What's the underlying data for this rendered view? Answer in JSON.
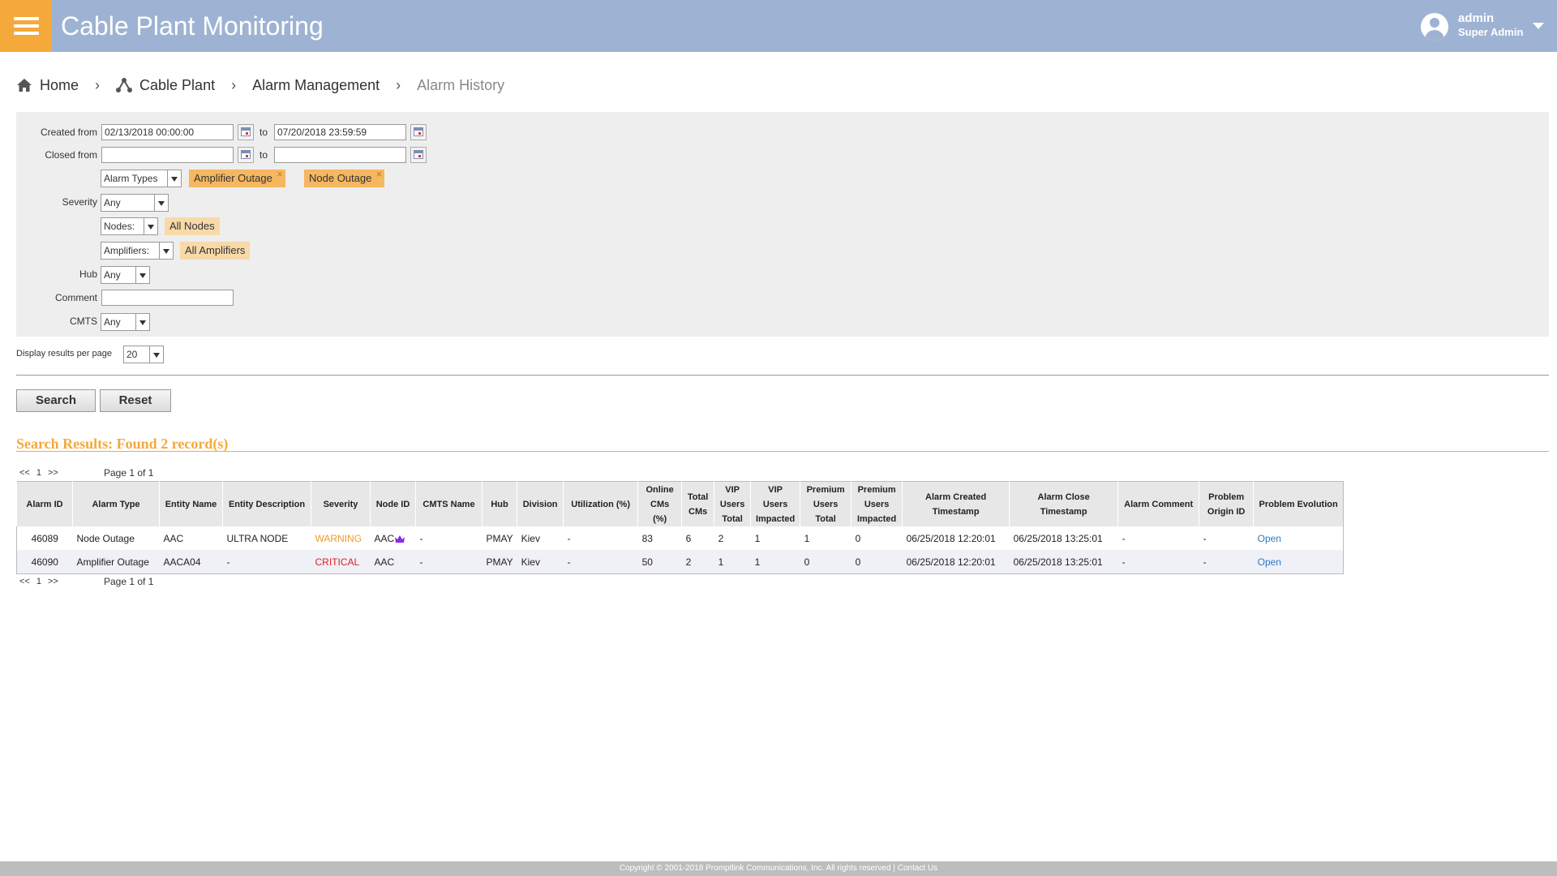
{
  "header": {
    "title": "Cable Plant Monitoring",
    "user_name": "admin",
    "user_role": "Super Admin",
    "colors": {
      "bar": "#9eb3d3",
      "menu": "#f5a93b"
    }
  },
  "breadcrumb": {
    "home": "Home",
    "cable_plant": "Cable Plant",
    "alarm_management": "Alarm Management",
    "current": "Alarm History",
    "separator": "›"
  },
  "filters": {
    "created_from_label": "Created from",
    "created_from_value": "02/13/2018 00:00:00",
    "to_label": "to",
    "created_to_value": "07/20/2018 23:59:59",
    "closed_from_label": "Closed from",
    "closed_from_value": "",
    "closed_to_value": "",
    "alarm_types_select": "Alarm Types",
    "alarm_type_chips": [
      "Amplifier Outage",
      "Node Outage"
    ],
    "severity_label": "Severity",
    "severity_value": "Any",
    "nodes_select": "Nodes:",
    "nodes_chip": "All Nodes",
    "amplifiers_select": "Amplifiers:",
    "amplifiers_chip": "All Amplifiers",
    "hub_label": "Hub",
    "hub_value": "Any",
    "comment_label": "Comment",
    "comment_value": "",
    "cmts_label": "CMTS",
    "cmts_value": "Any"
  },
  "display": {
    "per_page_label": "Display results per page",
    "per_page_value": "20"
  },
  "buttons": {
    "search": "Search",
    "reset": "Reset"
  },
  "results": {
    "title": "Search Results: Found 2 record(s)",
    "pager": {
      "prev": "<<",
      "page": "1",
      "next": ">>",
      "info": "Page 1 of 1"
    },
    "columns": [
      "Alarm ID",
      "Alarm Type",
      "Entity Name",
      "Entity Description",
      "Severity",
      "Node ID",
      "CMTS Name",
      "Hub",
      "Division",
      "Utilization (%)",
      "Online CMs (%)",
      "Total CMs",
      "VIP Users Total",
      "VIP Users Impacted",
      "Premium Users Total",
      "Premium Users Impacted",
      "Alarm Created Timestamp",
      "Alarm Close Timestamp",
      "Alarm Comment",
      "Problem Origin ID",
      "Problem Evolution"
    ],
    "rows": [
      [
        "46089",
        "Node Outage",
        "AAC",
        "ULTRA NODE",
        "WARNING",
        "AAC",
        "-",
        "PMAY",
        "Kiev",
        "-",
        "83",
        "6",
        "2",
        "1",
        "1",
        "0",
        "06/25/2018 12:20:01",
        "06/25/2018 13:25:01",
        "-",
        "-",
        "Open"
      ],
      [
        "46090",
        "Amplifier Outage",
        "AACA04",
        "-",
        "CRITICAL",
        "AAC",
        "-",
        "PMAY",
        "Kiev",
        "-",
        "50",
        "2",
        "1",
        "1",
        "0",
        "0",
        "06/25/2018 12:20:01",
        "06/25/2018 13:25:01",
        "-",
        "-",
        "Open"
      ]
    ],
    "severity_colors": {
      "WARNING": "#f39a2a",
      "CRITICAL": "#e02020"
    }
  },
  "footer": {
    "copyright": "Copyright © 2001-2018 Promptlink Communications, Inc. All rights reserved",
    "divider": " | ",
    "contact": "Contact Us"
  }
}
